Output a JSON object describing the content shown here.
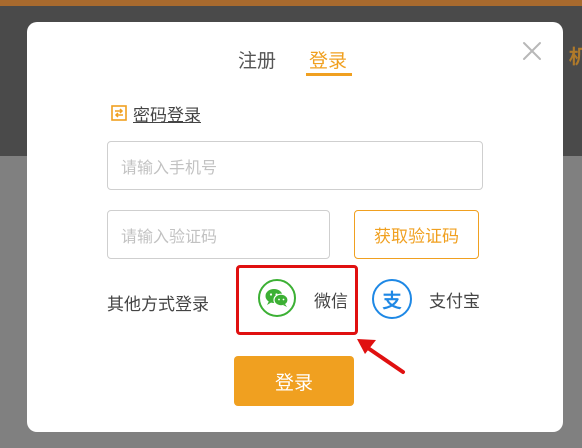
{
  "background": {
    "header_text": "机"
  },
  "modal": {
    "tabs": [
      {
        "label": "注册",
        "active": false
      },
      {
        "label": "登录",
        "active": true
      }
    ],
    "password_login_label": "密码登录",
    "phone_input": {
      "value": "",
      "placeholder": "请输入手机号"
    },
    "code_input": {
      "value": "",
      "placeholder": "请输入验证码"
    },
    "get_code_label": "获取验证码",
    "other_methods_label": "其他方式登录",
    "wechat_label": "微信",
    "alipay_label": "支付宝",
    "alipay_icon_char": "支",
    "submit_label": "登录"
  },
  "colors": {
    "accent": "#f0a020",
    "wechat": "#3cb034",
    "alipay": "#1e88e5",
    "highlight": "#e01010",
    "overlay": "#808080"
  },
  "icons": {
    "close": "close-icon",
    "password_login": "swap-icon",
    "wechat": "wechat-icon",
    "alipay": "alipay-icon",
    "annotation_arrow": "arrow-icon"
  }
}
